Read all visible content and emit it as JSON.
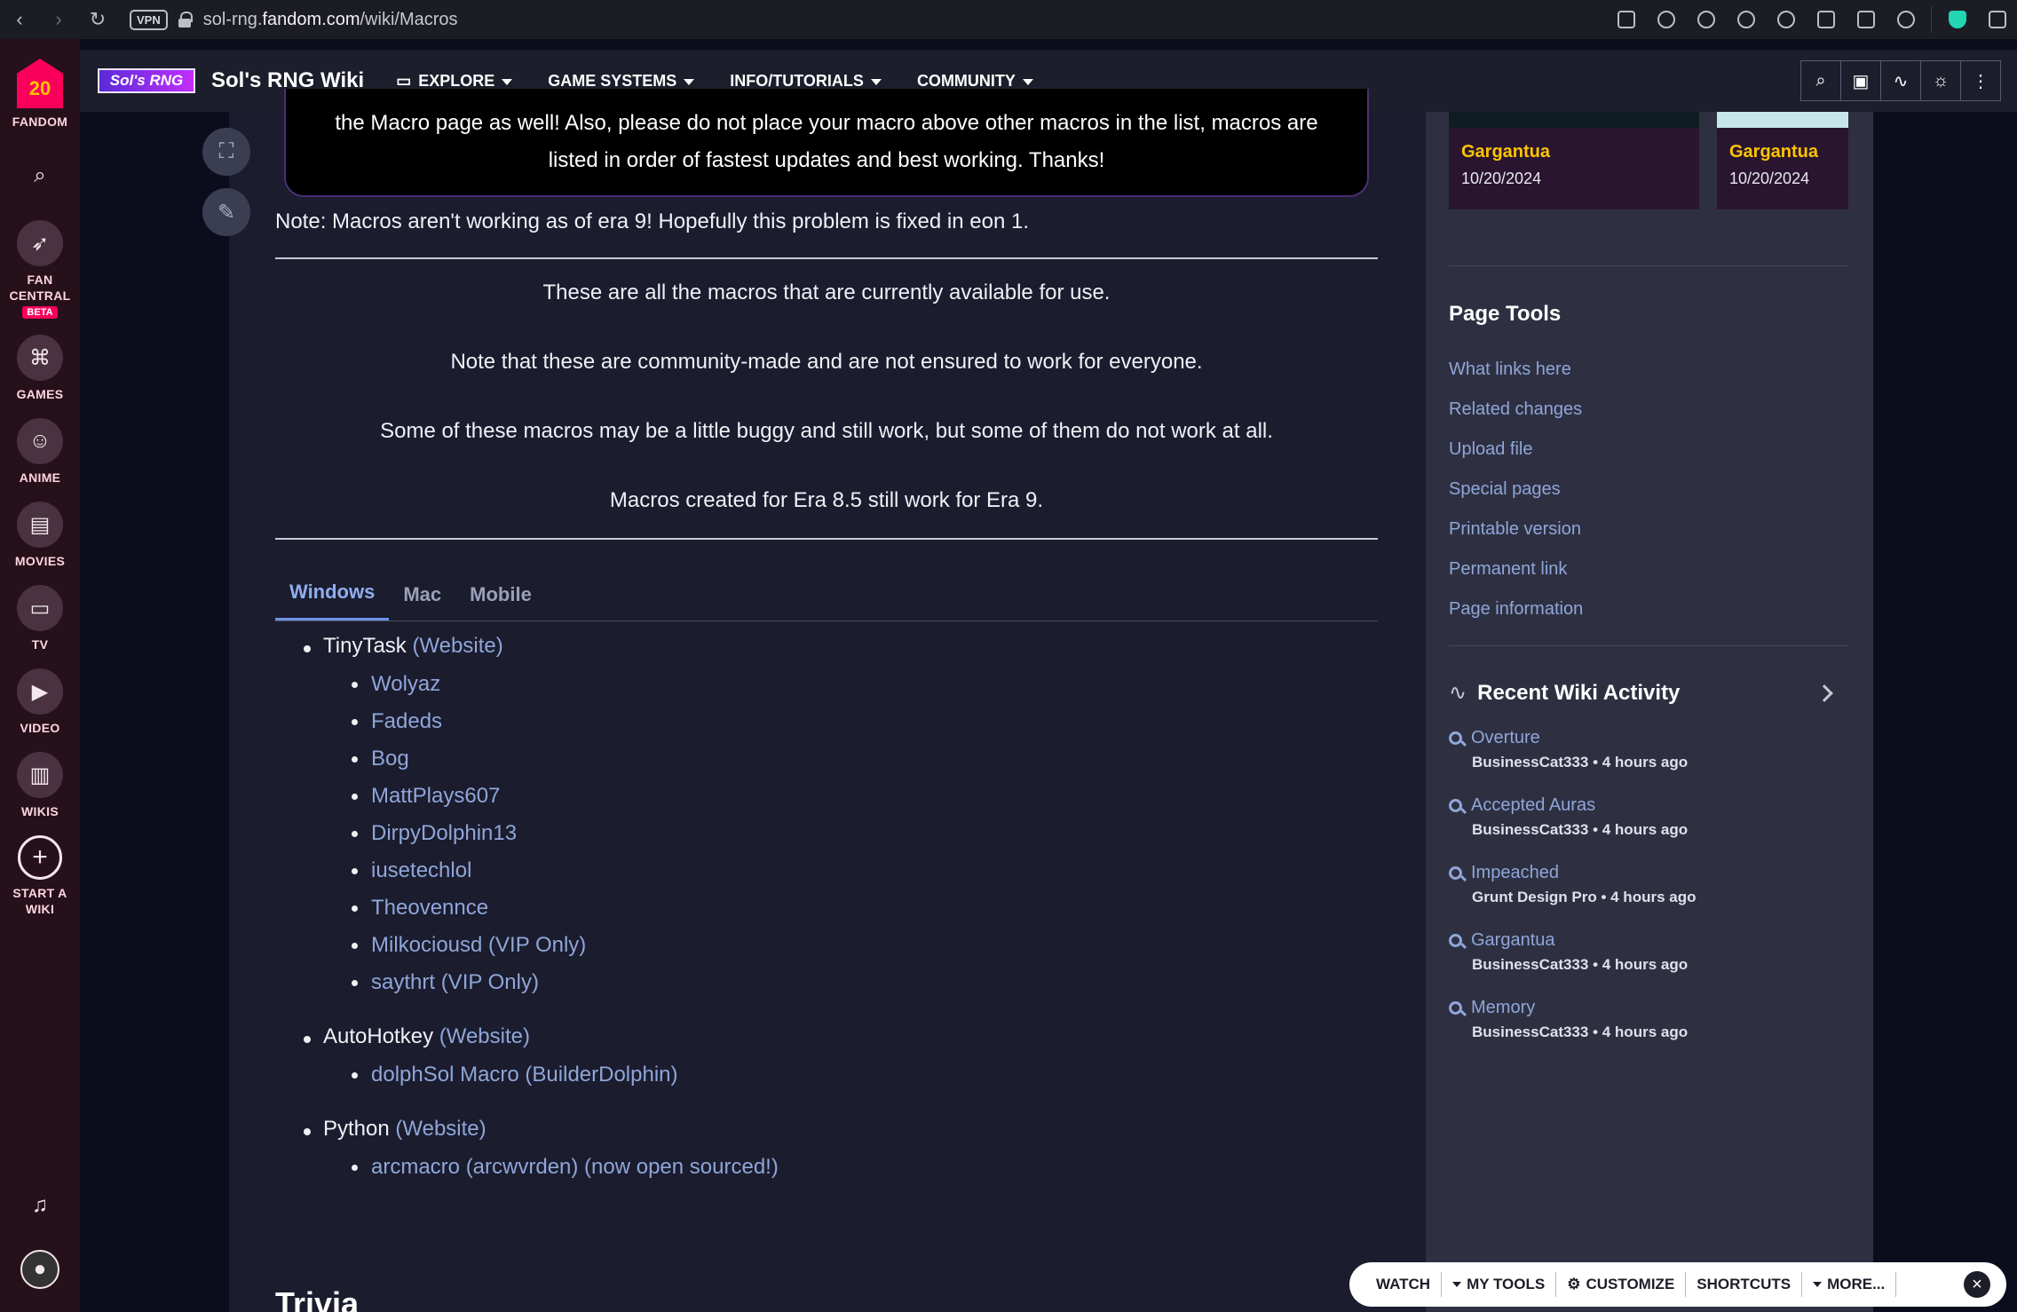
{
  "browser": {
    "vpn_label": "VPN",
    "url_prefix": "sol-rng.",
    "url_host": "fandom.com",
    "url_path": "/wiki/Macros"
  },
  "rail": {
    "logo_badge": "20",
    "logo_label": "FANDOM",
    "fan_central": "FAN CENTRAL",
    "beta": "BETA",
    "games": "GAMES",
    "anime": "ANIME",
    "movies": "MOVIES",
    "tv": "TV",
    "video": "VIDEO",
    "wikis": "WIKIS",
    "start_wiki": "START A WIKI"
  },
  "header": {
    "logo_text": "Sol's RNG",
    "wiki_name": "Sol's RNG Wiki",
    "nav": [
      "EXPLORE",
      "GAME SYSTEMS",
      "INFO/TUTORIALS",
      "COMMUNITY"
    ]
  },
  "article": {
    "notice_line1": "the Macro page as well! Also, please do not place your macro above other macros in the list, macros are",
    "notice_line2": "listed in order of fastest updates and best working. Thanks!",
    "note": "Note: Macros aren't working as of era 9! Hopefully this problem is fixed in eon 1.",
    "intro": [
      "These are all the macros that are currently available for use.",
      "Note that these are community-made and are not ensured to work for everyone.",
      "Some of these macros may be a little buggy and still work, but some of them do not work at all.",
      "Macros created for Era 8.5 still work for Era 9."
    ],
    "tabs": [
      "Windows",
      "Mac",
      "Mobile"
    ],
    "groups": [
      {
        "name": "TinyTask",
        "link": "(Website)",
        "items": [
          "Wolyaz",
          "Fadeds",
          "Bog",
          "MattPlays607",
          "DirpyDolphin13",
          "iusetechlol",
          "Theovennce",
          "Milkociousd (VIP Only)",
          "saythrt (VIP Only)"
        ]
      },
      {
        "name": "AutoHotkey",
        "link": "(Website)",
        "items": [
          "dolphSol Macro (BuilderDolphin)"
        ]
      },
      {
        "name": "Python",
        "link": "(Website)",
        "items": [
          "arcmacro (arcwvrden) (now open sourced!)"
        ]
      }
    ],
    "trivia": "Trivia"
  },
  "right_rail": {
    "cards": [
      {
        "title": "Gargantua",
        "date": "10/20/2024"
      },
      {
        "title": "Gargantua",
        "date": "10/20/2024"
      }
    ],
    "page_tools_title": "Page Tools",
    "page_tools": [
      "What links here",
      "Related changes",
      "Upload file",
      "Special pages",
      "Printable version",
      "Permanent link",
      "Page information"
    ],
    "activity_title": "Recent Wiki Activity",
    "activity": [
      {
        "page": "Overture",
        "meta": "BusinessCat333 • 4 hours ago"
      },
      {
        "page": "Accepted Auras",
        "meta": "BusinessCat333 • 4 hours ago"
      },
      {
        "page": "Impeached",
        "meta": "Grunt Design Pro • 4 hours ago"
      },
      {
        "page": "Gargantua",
        "meta": "BusinessCat333 • 4 hours ago"
      },
      {
        "page": "Memory",
        "meta": "BusinessCat333 • 4 hours ago"
      }
    ]
  },
  "toolbar": {
    "watch": "WATCH",
    "my_tools": "MY TOOLS",
    "customize": "CUSTOMIZE",
    "shortcuts": "SHORTCUTS",
    "more": "MORE..."
  }
}
